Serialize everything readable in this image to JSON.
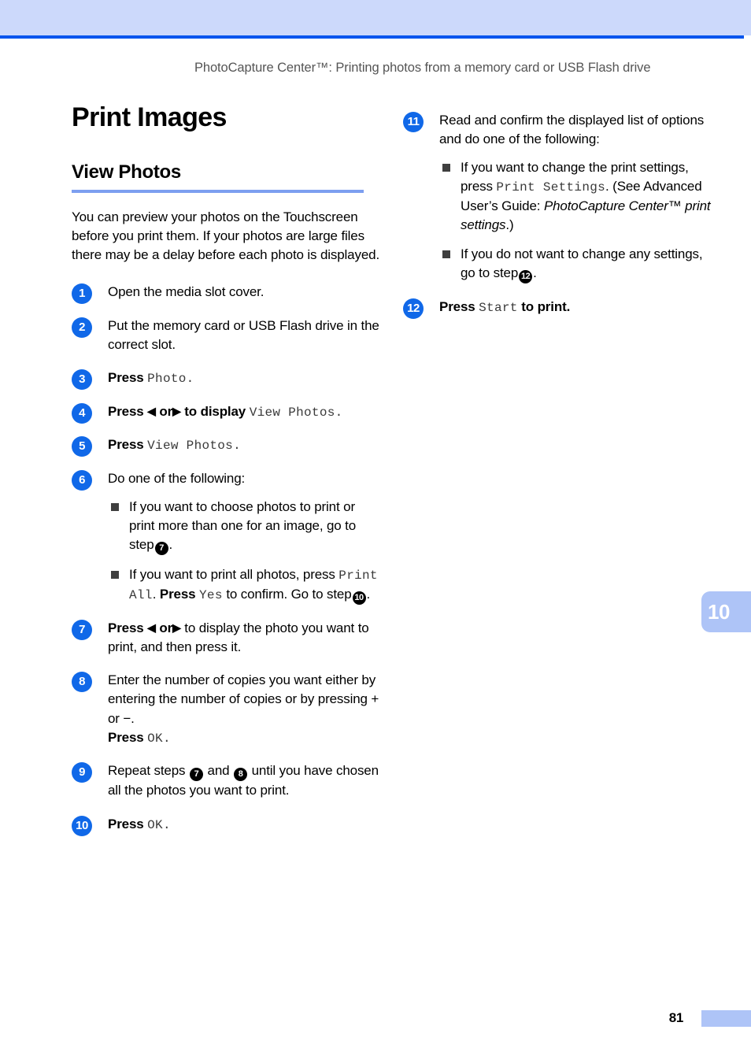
{
  "header": {
    "caption": "PhotoCapture Center™: Printing photos from a memory card or USB Flash drive",
    "band_color": "#ccd9fb",
    "rule_color": "#0055ee"
  },
  "page": {
    "title": "Print Images",
    "section_title": "View Photos",
    "section_rule_color": "#7d9ff0",
    "intro": "You can preview your photos on the Touchscreen before you print them. If your photos are large files there may be a delay before each photo is displayed.",
    "chapter_tab": "10",
    "page_number": "81",
    "accent_color": "#1068e8",
    "tab_color": "#aec4f7"
  },
  "steps": {
    "s1": {
      "num": "1",
      "text": "Open the media slot cover."
    },
    "s2": {
      "num": "2",
      "text": "Put the memory card or USB Flash drive in the correct slot."
    },
    "s3": {
      "num": "3",
      "press": "Press",
      "cmd": "Photo",
      "period": "."
    },
    "s4": {
      "num": "4",
      "press": "Press",
      "or": "or",
      "to_display": "to display",
      "cmd": "View Photos",
      "period": "."
    },
    "s5": {
      "num": "5",
      "press": "Press",
      "cmd": "View Photos",
      "period": "."
    },
    "s6": {
      "num": "6",
      "text": "Do one of the following:",
      "bullets": [
        {
          "part1": "If you want to choose photos to print or print more than one for an image, go to step",
          "ref": "7",
          "part2": "."
        },
        {
          "part1": "If you want to print all photos, press",
          "cmd1": "Print All",
          "part2": ".",
          "press": "Press",
          "cmd2": "Yes",
          "part3": "to confirm. Go to step",
          "ref": "10",
          "part4": "."
        }
      ]
    },
    "s7": {
      "num": "7",
      "press": "Press",
      "or": "or",
      "rest": "to display the photo you want to print, and then press it."
    },
    "s8": {
      "num": "8",
      "line1": "Enter the number of copies you want either by entering the number of copies or by pressing + or −.",
      "press": "Press",
      "cmd": "OK",
      "period": "."
    },
    "s9": {
      "num": "9",
      "part1": "Repeat steps",
      "ref1": "7",
      "and": "and",
      "ref2": "8",
      "part2": "until you have chosen all the photos you want to print."
    },
    "s10": {
      "num": "10",
      "press": "Press",
      "cmd": "OK",
      "period": "."
    },
    "s11": {
      "num": "11",
      "text": "Read and confirm the displayed list of options and do one of the following:",
      "bullets": [
        {
          "part1": "If you want to change the print settings, press",
          "cmd": "Print Settings",
          "part2": ". (See Advanced User’s Guide:",
          "italic": "PhotoCapture Center™ print settings",
          "part3": ".)"
        },
        {
          "part1": "If you do not want to change any settings, go to step",
          "ref": "12",
          "part2": "."
        }
      ]
    },
    "s12": {
      "num": "12",
      "press": "Press",
      "cmd": "Start",
      "rest": "to print."
    }
  },
  "icons": {
    "left_arrow": "◀",
    "right_arrow": "▶"
  }
}
